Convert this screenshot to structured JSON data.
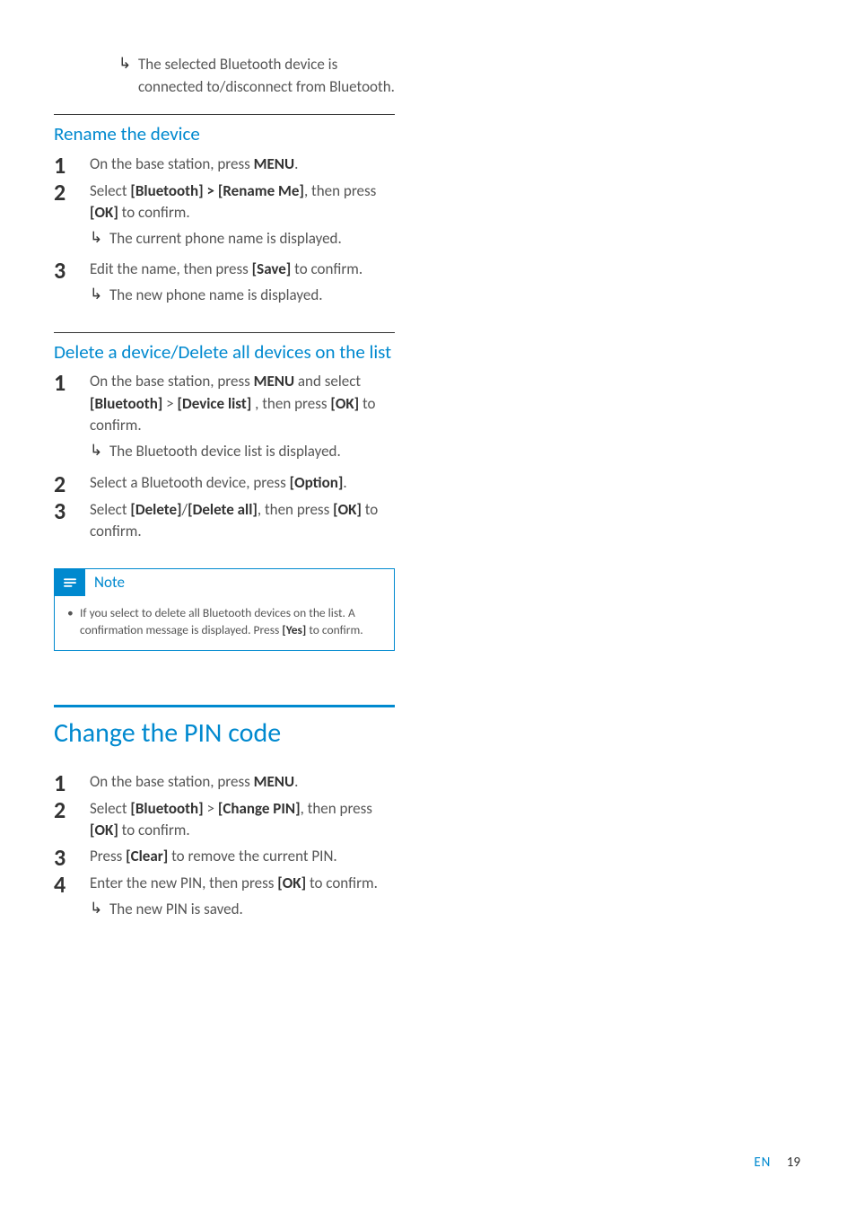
{
  "intro_result": "The selected Bluetooth device is connected to/disconnect from Bluetooth.",
  "rename": {
    "heading": "Rename the device",
    "step1_a": "On the base station, press ",
    "step1_b": "MENU",
    "step1_c": ".",
    "step2_a": "Select ",
    "step2_b": "[Bluetooth] > [Rename Me]",
    "step2_c": ", then press ",
    "step2_d": "[OK]",
    "step2_e": " to confirm.",
    "step2_result": "The current phone name is displayed.",
    "step3_a": "Edit the name, then press ",
    "step3_b": "[Save]",
    "step3_c": " to confirm.",
    "step3_result": "The new phone name is displayed."
  },
  "delete": {
    "heading": "Delete a device/Delete all devices on the list",
    "step1_a": "On the base station, press ",
    "step1_b": "MENU",
    "step1_c": " and select ",
    "step1_d": "[Bluetooth]",
    "step1_e": " > ",
    "step1_f": "[Device list]",
    "step1_g": " , then press ",
    "step1_h": "[OK]",
    "step1_i": " to confirm.",
    "step1_result": "The Bluetooth device list is displayed.",
    "step2_a": "Select a Bluetooth device, press ",
    "step2_b": "[Option]",
    "step2_c": ".",
    "step3_a": "Select ",
    "step3_b": "[Delete]",
    "step3_c": "/",
    "step3_d": "[Delete all]",
    "step3_e": ", then press ",
    "step3_f": "[OK]",
    "step3_g": " to confirm."
  },
  "note": {
    "title": "Note",
    "text_a": "If you select to delete all Bluetooth devices on the list. A confirmation message is displayed. Press ",
    "text_b": "[Yes]",
    "text_c": " to confirm."
  },
  "pin": {
    "heading": "Change the PIN code",
    "step1_a": "On the base station, press ",
    "step1_b": "MENU",
    "step1_c": ".",
    "step2_a": "Select ",
    "step2_b": "[Bluetooth]",
    "step2_c": " > ",
    "step2_d": "[Change PIN]",
    "step2_e": ", then press ",
    "step2_f": "[OK]",
    "step2_g": " to confirm.",
    "step3_a": "Press ",
    "step3_b": "[Clear]",
    "step3_c": " to remove the current PIN.",
    "step4_a": "Enter the new PIN, then press ",
    "step4_b": "[OK]",
    "step4_c": " to confirm.",
    "step4_result": "The new PIN is saved."
  },
  "footer": {
    "lang": "EN",
    "page": "19"
  }
}
